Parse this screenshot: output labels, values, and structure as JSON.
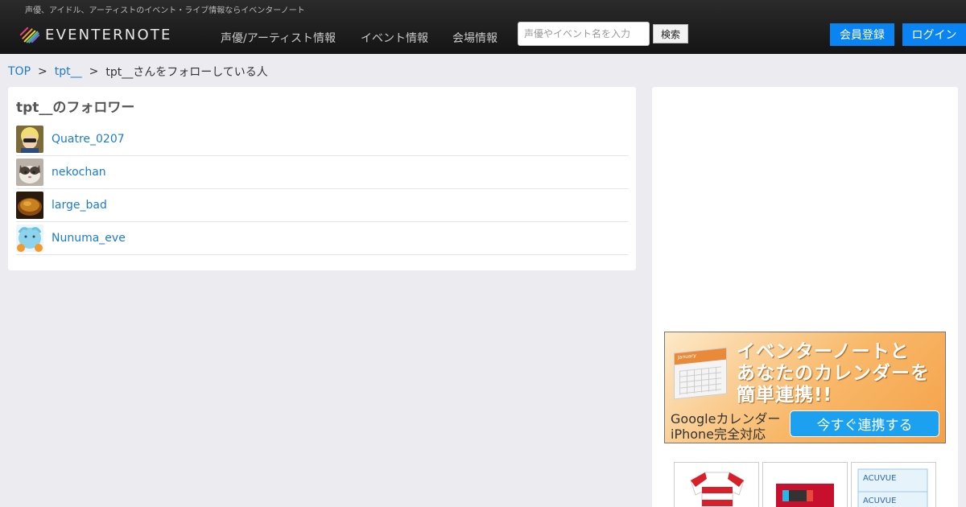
{
  "header": {
    "tagline": "声優、アイドル、アーティストのイベント・ライブ情報ならイベンターノート",
    "logo_text": "EVENTERNOTE",
    "nav": [
      {
        "label": "声優/アーティスト情報"
      },
      {
        "label": "イベント情報"
      },
      {
        "label": "会場情報"
      }
    ],
    "search": {
      "placeholder": "声優やイベント名を入力",
      "value": "",
      "button_label": "検索"
    },
    "register_label": "会員登録",
    "login_label": "ログイン"
  },
  "breadcrumb": {
    "items": [
      "TOP",
      "tpt__"
    ],
    "separator": ">",
    "current": "tpt__さんをフォローしている人"
  },
  "main": {
    "title": "tpt__のフォロワー",
    "followers": [
      {
        "name": "Quatre_0207",
        "avatar_icon": "user-avatar-icon"
      },
      {
        "name": "nekochan",
        "avatar_icon": "cat-avatar-icon"
      },
      {
        "name": "large_bad",
        "avatar_icon": "food-avatar-icon"
      },
      {
        "name": "Nunuma_eve",
        "avatar_icon": "character-avatar-icon"
      }
    ]
  },
  "sidebar": {
    "banner": {
      "line1": "イベンターノートと",
      "line2": "あなたのカレンダーを",
      "line3": "簡単連携!!",
      "sub1": "Googleカレンダー",
      "sub2": "iPhone完全対応",
      "cta": "今すぐ連携する",
      "calendar_label": "January"
    },
    "product_icons": [
      "jersey-product-image",
      "game-console-product-image",
      "contact-lens-product-image"
    ]
  },
  "colors": {
    "header_bg": "#1e1e1e",
    "accent": "#0a84f2",
    "link": "#1a7bd1",
    "page_bg": "#ebebf0"
  }
}
